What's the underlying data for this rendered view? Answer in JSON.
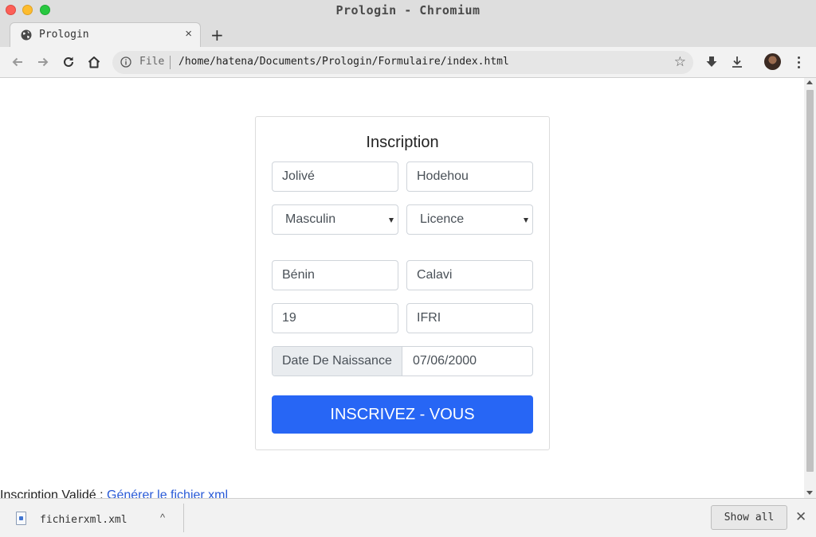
{
  "window": {
    "title": "Prologin - Chromium"
  },
  "tab": {
    "title": "Prologin",
    "close_glyph": "×",
    "icon": "globe-icon"
  },
  "new_tab_glyph": "+",
  "omnibox": {
    "scheme_label": "File",
    "url": "/home/hatena/Documents/Prologin/Formulaire/index.html",
    "star_glyph": "☆"
  },
  "form": {
    "title": "Inscription",
    "first_name": "Jolivé",
    "last_name": "Hodehou",
    "gender": "Masculin",
    "level": "Licence",
    "country": "Bénin",
    "city": "Calavi",
    "age": "19",
    "school": "IFRI",
    "birthdate_label": "Date De Naissance",
    "birthdate": "07/06/2000",
    "submit_label": "INSCRIVEZ - VOUS",
    "submit_color": "#2766f5"
  },
  "status": {
    "text": "Inscription Validé : ",
    "link_text": "Générer le fichier xml"
  },
  "downloads": {
    "file_name": "fichierxml.xml",
    "chevron_glyph": "^",
    "show_all_label": "Show all",
    "close_glyph": "✕"
  }
}
